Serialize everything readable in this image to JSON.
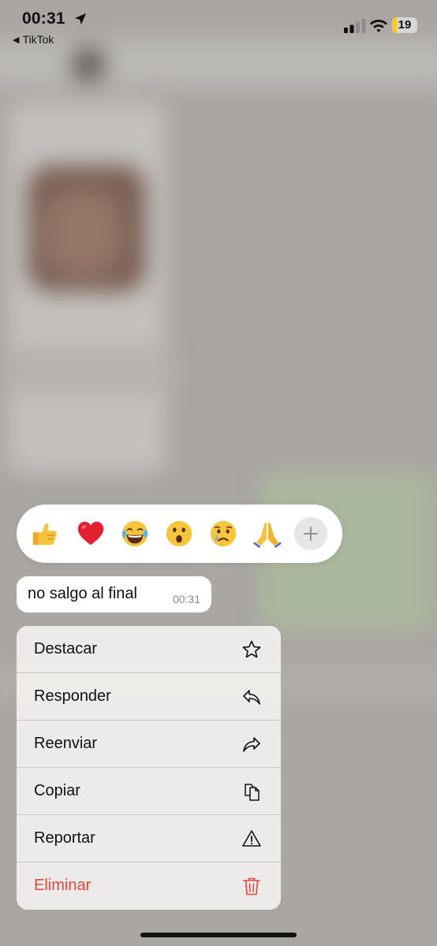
{
  "status_bar": {
    "time": "00:31",
    "back_app": "TikTok",
    "battery_level": "19",
    "battery_fraction": 0.19,
    "location_icon": "location-arrow-icon",
    "signal_icon": "cellular-signal-icon",
    "wifi_icon": "wifi-icon"
  },
  "reactions": [
    {
      "icon": "thumbs-up-icon"
    },
    {
      "icon": "red-heart-icon"
    },
    {
      "icon": "tears-of-joy-icon"
    },
    {
      "icon": "surprised-face-icon"
    },
    {
      "icon": "crying-face-icon"
    },
    {
      "icon": "folded-hands-icon"
    },
    {
      "icon": "plus-icon"
    }
  ],
  "message": {
    "text": "no salgo al final",
    "time": "00:31"
  },
  "menu": {
    "items": [
      {
        "label": "Destacar",
        "icon": "star-icon"
      },
      {
        "label": "Responder",
        "icon": "reply-icon"
      },
      {
        "label": "Reenviar",
        "icon": "forward-icon"
      },
      {
        "label": "Copiar",
        "icon": "copy-icon"
      },
      {
        "label": "Reportar",
        "icon": "warning-icon"
      },
      {
        "label": "Eliminar",
        "icon": "trash-icon"
      }
    ]
  },
  "colors": {
    "danger": "#e8443a",
    "battery": "#f5cc1f"
  }
}
